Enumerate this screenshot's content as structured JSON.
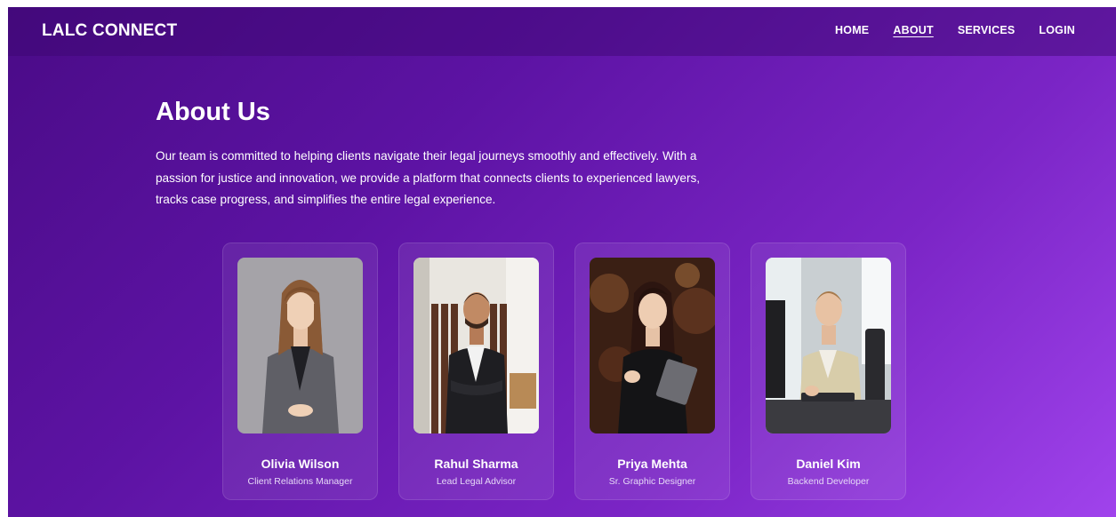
{
  "nav": {
    "brand": "LALC CONNECT",
    "links": [
      {
        "label": "HOME"
      },
      {
        "label": "ABOUT"
      },
      {
        "label": "SERVICES"
      },
      {
        "label": "LOGIN"
      }
    ]
  },
  "about": {
    "title": "About Us",
    "description": "Our team is committed to helping clients navigate their legal journeys smoothly and effectively. With a passion for justice and innovation, we provide a platform that connects clients to experienced lawyers, tracks case progress, and simplifies the entire legal experience."
  },
  "team": [
    {
      "name": "Olivia Wilson",
      "role": "Client Relations Manager"
    },
    {
      "name": "Rahul Sharma",
      "role": "Lead Legal Advisor"
    },
    {
      "name": "Priya Mehta",
      "role": "Sr. Graphic Designer"
    },
    {
      "name": "Daniel Kim",
      "role": "Backend Developer"
    }
  ],
  "colors": {
    "gradient_start": "#4a0b87",
    "gradient_end": "#a043ec",
    "text": "#ffffff"
  }
}
